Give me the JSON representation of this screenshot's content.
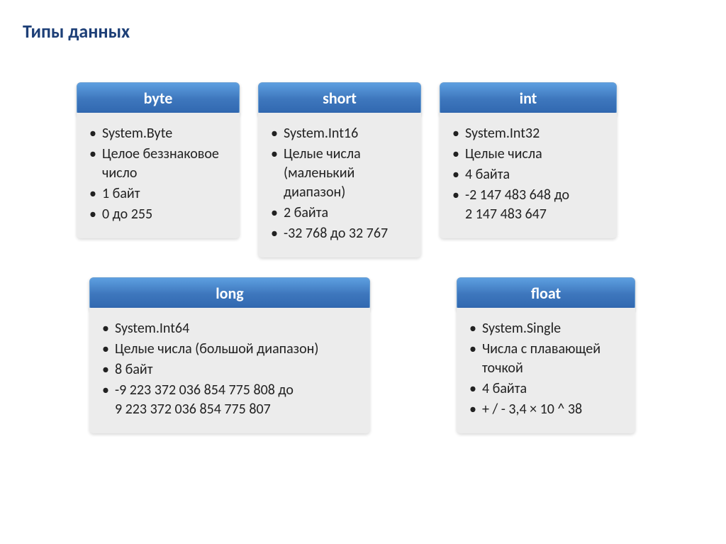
{
  "title": "Типы данных",
  "cards": {
    "byte": {
      "header": "byte",
      "items": [
        "System.Byte",
        "Целое беззнаковое число",
        "1 байт",
        "0 до 255"
      ]
    },
    "short": {
      "header": "short",
      "items": [
        "System.Int16",
        "Целые числа (маленький диапазон)",
        "2 байта",
        "-32 768 до 32 767"
      ]
    },
    "int": {
      "header": "int",
      "items": [
        "System.Int32",
        "Целые числа",
        "4 байта"
      ],
      "range_line1": "-2 147 483 648 до",
      "range_line2": "2 147 483 647"
    },
    "long": {
      "header": "long",
      "items": [
        "System.Int64",
        "Целые числа (большой диапазон)",
        "8 байт"
      ],
      "range_line1": "-9 223 372 036 854 775 808 до",
      "range_line2": "9 223 372 036 854 775 807"
    },
    "float": {
      "header": "float",
      "items": [
        "System.Single",
        "Числа с плавающей точкой",
        "4 байта",
        "+ / - 3,4 × 10 ^ 38"
      ]
    }
  }
}
